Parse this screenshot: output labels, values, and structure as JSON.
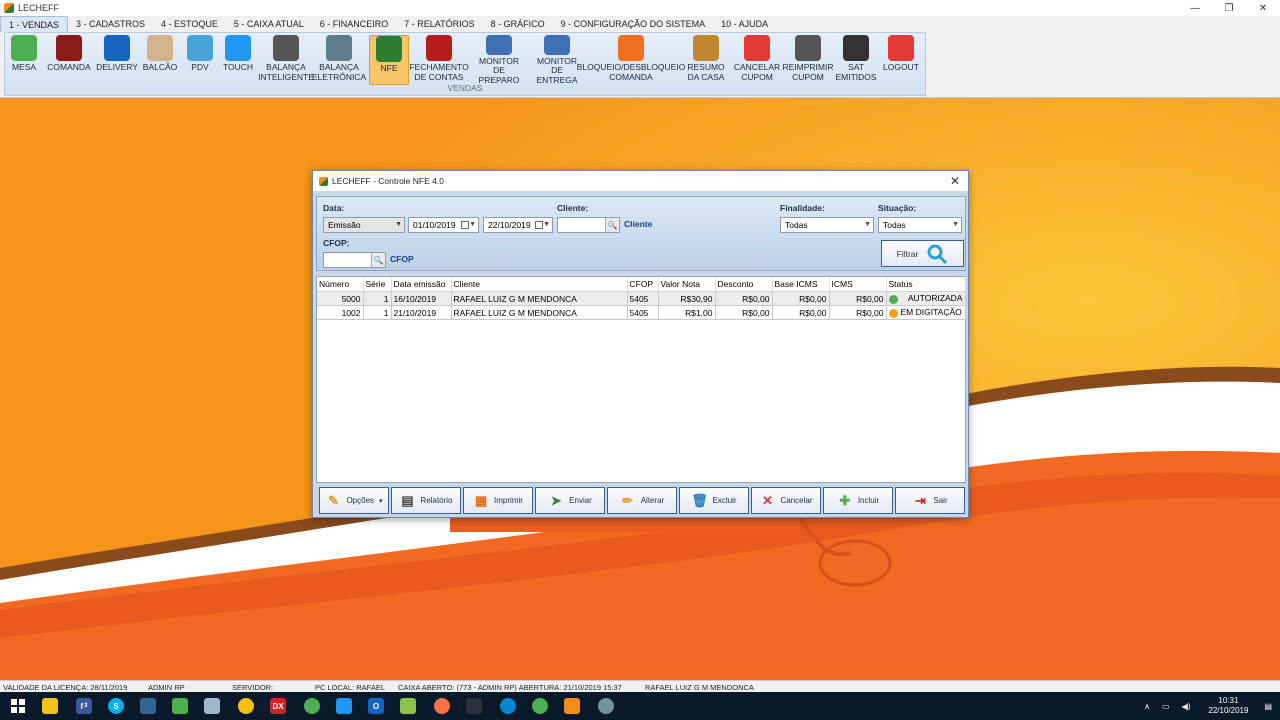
{
  "app": {
    "title": "LECHEFF",
    "win_min": "—",
    "win_max": "❐",
    "win_close": "✕"
  },
  "menu_tabs": [
    {
      "label": "1 - VENDAS",
      "active": true
    },
    {
      "label": "3 - CADASTROS"
    },
    {
      "label": "4 - ESTOQUE"
    },
    {
      "label": "5 - CAIXA ATUAL"
    },
    {
      "label": "6 - FINANCEIRO"
    },
    {
      "label": "7 - RELATÓRIOS"
    },
    {
      "label": "8 - GRÁFICO"
    },
    {
      "label": "9 - CONFIGURAÇÃO DO SISTEMA"
    },
    {
      "label": "10 - AJUDA"
    }
  ],
  "ribbon": {
    "group_label": "VENDAS",
    "buttons": [
      {
        "label": "MESA",
        "icon": "fork-knife-icon",
        "color": "#4caf50"
      },
      {
        "label": "COMANDA",
        "icon": "order-pad-icon",
        "color": "#8b1a1a"
      },
      {
        "label": "DELIVERY",
        "icon": "telephone-icon",
        "color": "#1565c0"
      },
      {
        "label": "BALCÃO",
        "icon": "counter-icon",
        "color": "#d2b48c"
      },
      {
        "label": "PDV",
        "icon": "basket-icon",
        "color": "#4aa3d8"
      },
      {
        "label": "TOUCH",
        "icon": "touch-screen-icon",
        "color": "#2196f3"
      },
      {
        "label": "BALANÇA\nINTELIGENTE",
        "icon": "scale-icon",
        "color": "#555555"
      },
      {
        "label": "BALANÇA\nELETRÔNICA",
        "icon": "electronic-scale-icon",
        "color": "#607d8b"
      },
      {
        "label": "NFE",
        "icon": "nfe-document-icon",
        "color": "#2e7d32",
        "selected": true
      },
      {
        "label": "FECHAMENTO\nDE CONTAS",
        "icon": "cash-register-icon",
        "color": "#b71c1c"
      },
      {
        "label": "MONITOR\nDE PREPARO",
        "icon": "monitor-prep-icon",
        "color": "#3f6fb5"
      },
      {
        "label": "MONITOR\nDE ENTREGA",
        "icon": "monitor-delivery-icon",
        "color": "#3f6fb5"
      },
      {
        "label": "BLOQUEIO/DESBLOQUEIO\nCOMANDA",
        "icon": "lock-order-icon",
        "color": "#f07020"
      },
      {
        "label": "RESUMO\nDA CASA",
        "icon": "jar-icon",
        "color": "#c0872e"
      },
      {
        "label": "CANCELAR\nCUPOM",
        "icon": "cancel-icon",
        "color": "#e53935"
      },
      {
        "label": "REIMPRIMIR\nCUPOM",
        "icon": "printer-icon",
        "color": "#555555"
      },
      {
        "label": "SAT\nEMITIDOS",
        "icon": "sat-icon",
        "color": "#333333"
      },
      {
        "label": "LOGOUT",
        "icon": "user-logout-icon",
        "color": "#e53935"
      }
    ]
  },
  "dialog": {
    "title": "LECHEFF - Controle NFE 4.0",
    "filters": {
      "data_label": "Data:",
      "data_type": "Emissão",
      "date_from": "01/10/2019",
      "date_to": "22/10/2019",
      "cliente_label": "Cliente:",
      "cliente_link": "Cliente",
      "cfop_label": "CFOP:",
      "cfop_link": "CFOP",
      "finalidade_label": "Finalidade:",
      "finalidade_value": "Todas",
      "situacao_label": "Situação:",
      "situacao_value": "Todas",
      "filtrar": "Filtrar"
    },
    "table": {
      "headers": [
        "Número",
        "Série",
        "Data emissão",
        "Cliente",
        "CFOP",
        "Valor Nota",
        "Desconto",
        "Base ICMS",
        "ICMS",
        "Status"
      ],
      "rows": [
        [
          "5000",
          "1",
          "16/10/2019",
          "RAFAEL LUIZ G M MENDONCA",
          "5405",
          "R$30,90",
          "R$0,00",
          "R$0,00",
          "R$0,00",
          "AUTORIZADA"
        ],
        [
          "1002",
          "1",
          "21/10/2019",
          "RAFAEL LUIZ G M MENDONCA",
          "5405",
          "R$1,00",
          "R$0,00",
          "R$0,00",
          "R$0,00",
          "EM DIGITAÇÃO"
        ]
      ]
    },
    "actions": [
      "Opções",
      "Relatório",
      "Imprimir",
      "Enviar",
      "Alterar",
      "Excluir",
      "Cancelar",
      "Incluir",
      "Sair"
    ]
  },
  "statusbar": {
    "licenca": "VALIDADE DA LICENÇA: 28/11/2019",
    "user": "ADMIN RP",
    "servidor": "SERVIDOR:",
    "pc": "PC LOCAL: RAFAEL",
    "caixa": "CAIXA ABERTO: (773 - ADMIN RP) ABERTURA: 21/10/2019 15:37",
    "cliente": "RAFAEL LUIZ G M MENDONCA"
  },
  "taskbar": {
    "time": "10:31",
    "date": "22/10/2019",
    "badge": "3"
  },
  "colors": {
    "accent": "#3a5f93",
    "wallpaper": "#f59a10",
    "dialog_bg": "#c8d6e6"
  }
}
